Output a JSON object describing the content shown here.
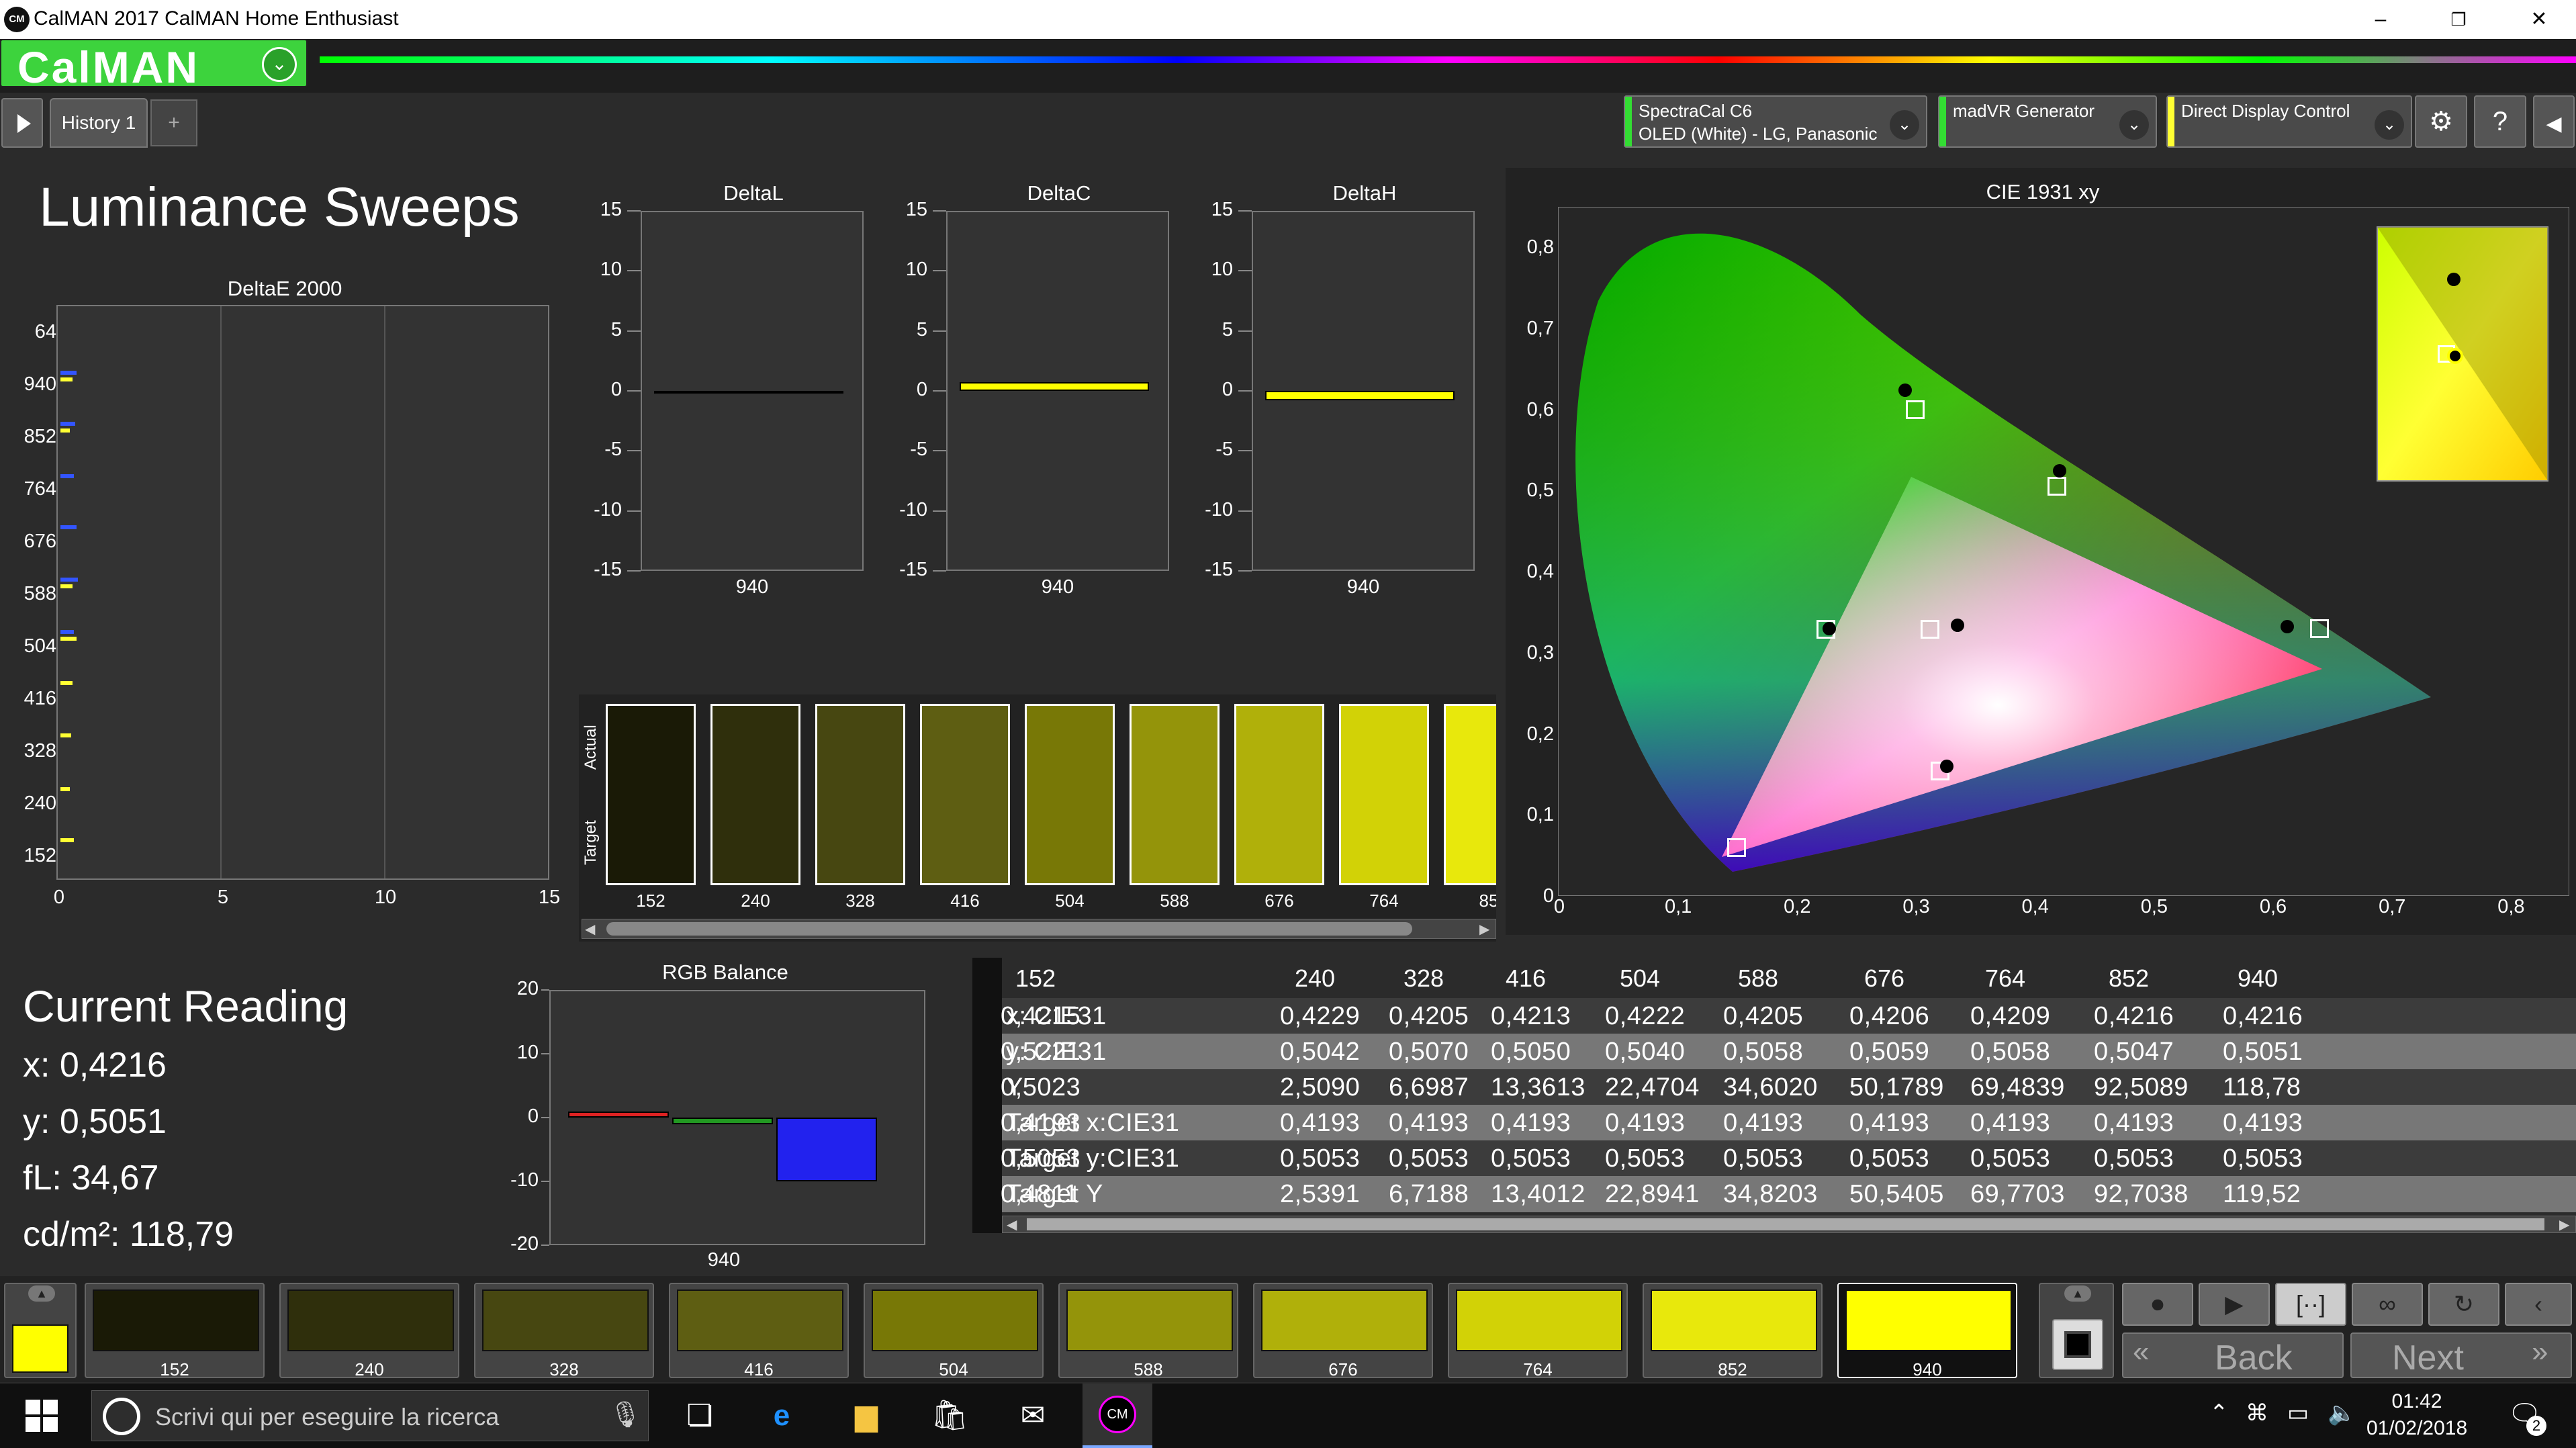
{
  "window": {
    "title": "CalMAN 2017 CalMAN Home Enthusiast",
    "app_icon": "CM",
    "controls": [
      "–",
      "❐",
      "✕"
    ]
  },
  "header": {
    "logo": "CalMAN",
    "logo_dropdown": "⌄"
  },
  "tabs": {
    "items": [
      "History 1"
    ],
    "add": "+"
  },
  "devices": [
    {
      "line1": "SpectraCal C6",
      "line2": "OLED (White) - LG, Panasonic",
      "color": "#33dd33"
    },
    {
      "line1": "madVR Generator",
      "line2": "",
      "color": "#33dd33"
    },
    {
      "line1": "Direct Display Control",
      "line2": "",
      "color": "#ffff33"
    }
  ],
  "toolbar_icons": [
    "gear-icon",
    "help-icon",
    "collapse-icon"
  ],
  "page": {
    "title": "Luminance Sweeps"
  },
  "delta_e": {
    "title": "DeltaE 2000",
    "y_labels": [
      "64",
      "940",
      "852",
      "764",
      "676",
      "588",
      "504",
      "416",
      "328",
      "240",
      "152"
    ],
    "x_labels": [
      "0",
      "5",
      "10",
      "15"
    ]
  },
  "small_charts": [
    {
      "title": "DeltaL",
      "xlabel": "940",
      "value": -0.1,
      "fill": "#cccc00"
    },
    {
      "title": "DeltaC",
      "xlabel": "940",
      "value": 0.7,
      "fill": "#ffff00"
    },
    {
      "title": "DeltaH",
      "xlabel": "940",
      "value": -0.8,
      "fill": "#ffff00"
    }
  ],
  "small_ticks": [
    "15",
    "10",
    "5",
    "0",
    "-5",
    "-10",
    "-15"
  ],
  "swatch_panel": {
    "labels": {
      "actual": "Actual",
      "target": "Target"
    },
    "swatches": [
      {
        "label": "152",
        "color": "#1a1a06"
      },
      {
        "label": "240",
        "color": "#2f2f0c"
      },
      {
        "label": "328",
        "color": "#474711"
      },
      {
        "label": "416",
        "color": "#5e5e12"
      },
      {
        "label": "504",
        "color": "#787806"
      },
      {
        "label": "588",
        "color": "#94940a"
      },
      {
        "label": "676",
        "color": "#b0b00a"
      },
      {
        "label": "764",
        "color": "#d2d206"
      },
      {
        "label": "85",
        "color": "#e8e80c"
      }
    ]
  },
  "cie": {
    "title": "CIE 1931 xy",
    "y_labels": [
      "0,8",
      "0,7",
      "0,6",
      "0,5",
      "0,4",
      "0,3",
      "0,2",
      "0,1",
      "0"
    ],
    "x_labels": [
      "0",
      "0,1",
      "0,2",
      "0,3",
      "0,4",
      "0,5",
      "0,6",
      "0,7",
      "0,8"
    ]
  },
  "current_reading": {
    "title": "Current Reading",
    "x": "x: 0,4216",
    "y": "y: 0,5051",
    "fl": "fL: 34,67",
    "cdm2": "cd/m²: 118,79"
  },
  "rgb_balance": {
    "title": "RGB Balance",
    "y_labels": [
      "20",
      "10",
      "0",
      "-10",
      "-20"
    ],
    "xlabel": "940",
    "bars": [
      {
        "name": "Red",
        "value": 1.0,
        "color": "#dd2222"
      },
      {
        "name": "Green",
        "value": -1.0,
        "color": "#229922"
      },
      {
        "name": "Blue",
        "value": -10.0,
        "color": "#2222ee"
      }
    ]
  },
  "table": {
    "columns": [
      "152",
      "240",
      "328",
      "416",
      "504",
      "588",
      "676",
      "764",
      "852",
      "940"
    ],
    "rows": [
      {
        "label": "x: CIE31",
        "values": [
          "0,4215",
          "0,4229",
          "0,4205",
          "0,4213",
          "0,4222",
          "0,4205",
          "0,4206",
          "0,4209",
          "0,4216",
          "0,4216"
        ]
      },
      {
        "label": "y: CIE31",
        "values": [
          "0,5221",
          "0,5042",
          "0,5070",
          "0,5050",
          "0,5040",
          "0,5058",
          "0,5059",
          "0,5058",
          "0,5047",
          "0,5051"
        ]
      },
      {
        "label": "Y",
        "values": [
          "0,5023",
          "2,5090",
          "6,6987",
          "13,3613",
          "22,4704",
          "34,6020",
          "50,1789",
          "69,4839",
          "92,5089",
          "118,78"
        ]
      },
      {
        "label": "Target x:CIE31",
        "values": [
          "0,4193",
          "0,4193",
          "0,4193",
          "0,4193",
          "0,4193",
          "0,4193",
          "0,4193",
          "0,4193",
          "0,4193",
          "0,4193"
        ]
      },
      {
        "label": "Target y:CIE31",
        "values": [
          "0,5053",
          "0,5053",
          "0,5053",
          "0,5053",
          "0,5053",
          "0,5053",
          "0,5053",
          "0,5053",
          "0,5053",
          "0,5053"
        ]
      },
      {
        "label": "Target Y",
        "values": [
          "0,4811",
          "2,5391",
          "6,7188",
          "13,4012",
          "22,8941",
          "34,8203",
          "50,5405",
          "69,7703",
          "92,7038",
          "119,52"
        ]
      }
    ]
  },
  "strip": {
    "current_color": "#ffff00",
    "tiles": [
      {
        "label": "152",
        "color": "#1a1a06"
      },
      {
        "label": "240",
        "color": "#2f2f0c"
      },
      {
        "label": "328",
        "color": "#474711"
      },
      {
        "label": "416",
        "color": "#5e5e12"
      },
      {
        "label": "504",
        "color": "#787806"
      },
      {
        "label": "588",
        "color": "#94940a"
      },
      {
        "label": "676",
        "color": "#b0b00a"
      },
      {
        "label": "764",
        "color": "#d2d206"
      },
      {
        "label": "852",
        "color": "#e8e80c"
      },
      {
        "label": "940",
        "color": "#ffff00"
      }
    ],
    "back": "Back",
    "next": "Next"
  },
  "taskbar": {
    "search_placeholder": "Scrivi qui per eseguire la ricerca",
    "time": "01:42",
    "date": "01/02/2018",
    "notifications": "2"
  }
}
